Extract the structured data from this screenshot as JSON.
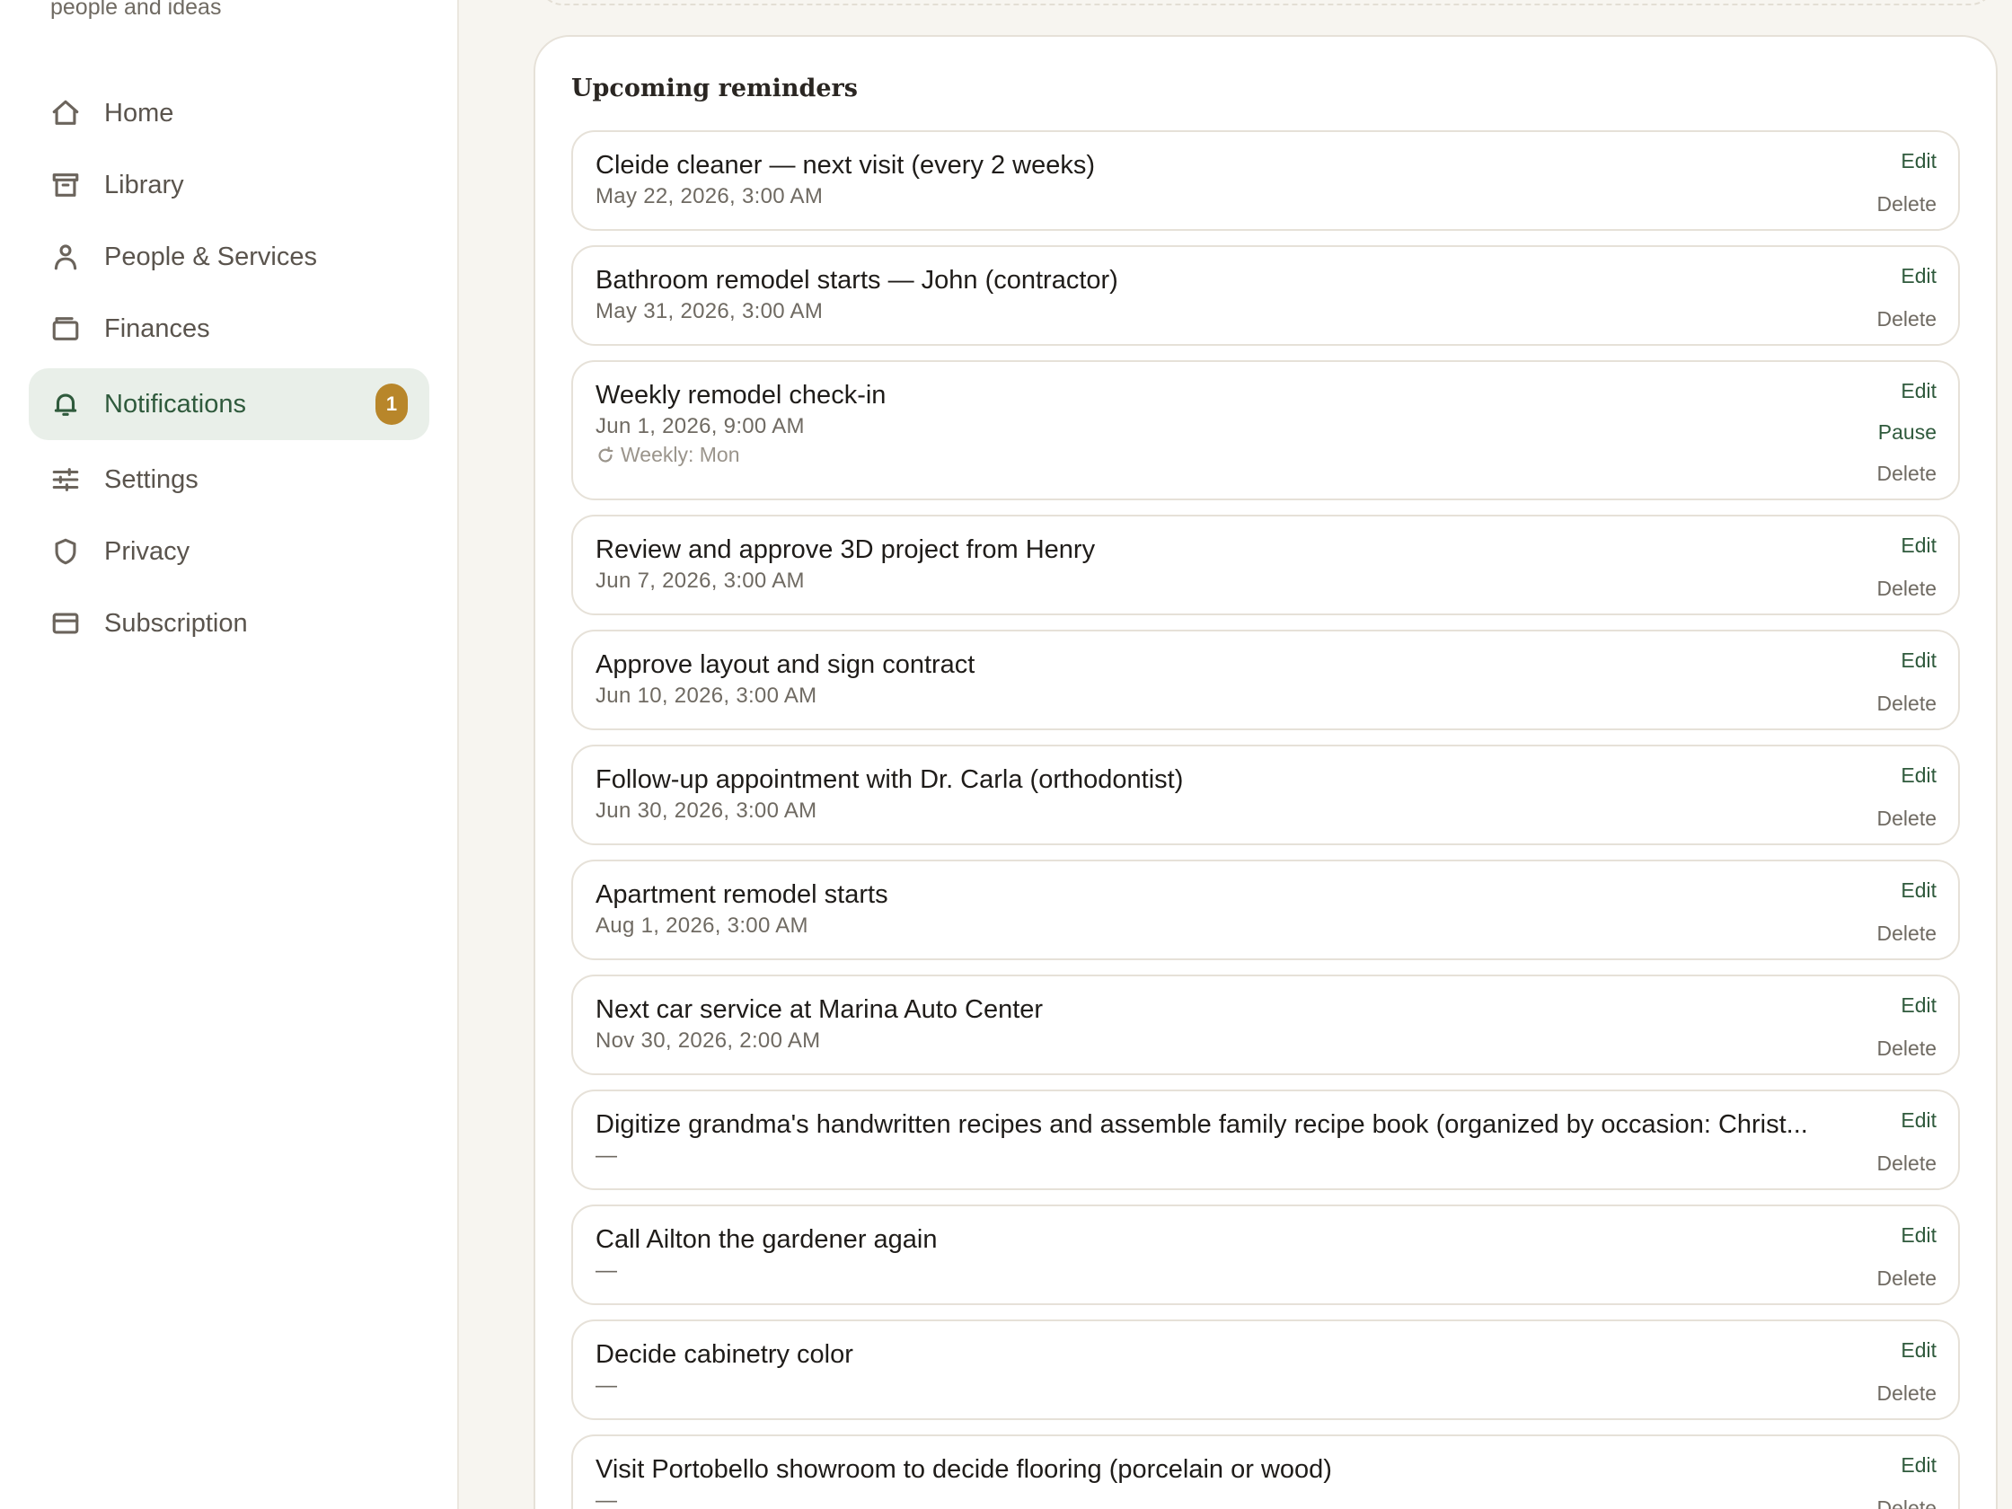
{
  "sidebar": {
    "tagline": "people and ideas",
    "items": [
      {
        "label": "Home",
        "icon": "home-icon"
      },
      {
        "label": "Library",
        "icon": "archive-icon"
      },
      {
        "label": "People & Services",
        "icon": "person-icon"
      },
      {
        "label": "Finances",
        "icon": "wallet-icon"
      },
      {
        "label": "Notifications",
        "icon": "bell-icon",
        "active": true,
        "badge": "1"
      },
      {
        "label": "Settings",
        "icon": "sliders-icon"
      },
      {
        "label": "Privacy",
        "icon": "shield-icon"
      },
      {
        "label": "Subscription",
        "icon": "card-icon"
      }
    ]
  },
  "main": {
    "section_title": "Upcoming reminders",
    "actions": {
      "edit": "Edit",
      "pause": "Pause",
      "delete": "Delete"
    },
    "reminders": [
      {
        "title": "Cleide cleaner — next visit (every 2 weeks)",
        "date": "May 22, 2026, 3:00 AM"
      },
      {
        "title": "Bathroom remodel starts — John (contractor)",
        "date": "May 31, 2026, 3:00 AM"
      },
      {
        "title": "Weekly remodel check-in",
        "date": "Jun 1, 2026, 9:00 AM",
        "recurrence": "Weekly: Mon"
      },
      {
        "title": "Review and approve 3D project from Henry",
        "date": "Jun 7, 2026, 3:00 AM"
      },
      {
        "title": "Approve layout and sign contract",
        "date": "Jun 10, 2026, 3:00 AM"
      },
      {
        "title": "Follow-up appointment with Dr. Carla (orthodontist)",
        "date": "Jun 30, 2026, 3:00 AM"
      },
      {
        "title": "Apartment remodel starts",
        "date": "Aug 1, 2026, 3:00 AM"
      },
      {
        "title": "Next car service at Marina Auto Center",
        "date": "Nov 30, 2026, 2:00 AM"
      },
      {
        "title": "Digitize grandma's handwritten recipes and assemble family recipe book (organized by occasion: Christ...",
        "date": "—"
      },
      {
        "title": "Call Ailton the gardener again",
        "date": "—"
      },
      {
        "title": "Decide cabinetry color",
        "date": "—"
      },
      {
        "title": "Visit Portobello showroom to decide flooring (porcelain or wood)",
        "date": "—"
      }
    ]
  }
}
